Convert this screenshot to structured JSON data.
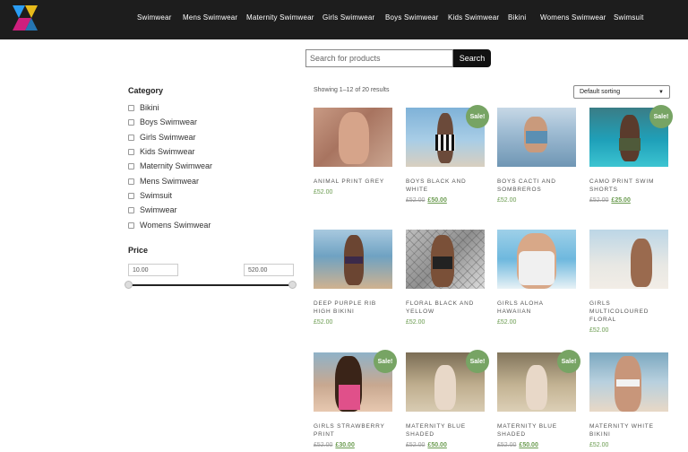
{
  "nav": {
    "items": [
      "Swimwear",
      "Mens Swimwear",
      "Maternity Swimwear",
      "Girls Swimwear",
      "Boys Swimwear",
      "Kids Swimwear",
      "Bikini",
      "Womens Swimwear",
      "Swimsuit"
    ]
  },
  "search": {
    "placeholder": "Search for products",
    "button": "Search"
  },
  "sidebar": {
    "category_title": "Category",
    "categories": [
      "Bikini",
      "Boys Swimwear",
      "Girls Swimwear",
      "Kids Swimwear",
      "Maternity Swimwear",
      "Mens Swimwear",
      "Swimsuit",
      "Swimwear",
      "Womens Swimwear"
    ],
    "price_title": "Price",
    "price_min": "10.00",
    "price_max": "520.00"
  },
  "results": {
    "count_text": "Showing 1–12 of 20 results",
    "sort_selected": "Default sorting"
  },
  "colors": {
    "header_bg": "#1d1d1d",
    "sale_badge": "#77a464",
    "price_green": "#6a9b4f"
  },
  "sale_label": "Sale!",
  "products": [
    {
      "title": "ANIMAL PRINT GREY",
      "price": "£52.00",
      "old_price": "",
      "sale": false
    },
    {
      "title": "BOYS BLACK AND WHITE",
      "price": "£50.00",
      "old_price": "£52.00",
      "sale": true
    },
    {
      "title": "BOYS CACTI AND SOMBREROS",
      "price": "£52.00",
      "old_price": "",
      "sale": false
    },
    {
      "title": "CAMO PRINT SWIM SHORTS",
      "price": "£25.00",
      "old_price": "£52.00",
      "sale": true
    },
    {
      "title": "DEEP PURPLE RIB HIGH BIKINI",
      "price": "£52.00",
      "old_price": "",
      "sale": false
    },
    {
      "title": "FLORAL BLACK AND YELLOW",
      "price": "£52.00",
      "old_price": "",
      "sale": false
    },
    {
      "title": "GIRLS ALOHA HAWAIIAN",
      "price": "£52.00",
      "old_price": "",
      "sale": false
    },
    {
      "title": "GIRLS MULTICOLOURED FLORAL",
      "price": "£52.00",
      "old_price": "",
      "sale": false
    },
    {
      "title": "GIRLS STRAWBERRY PRINT",
      "price": "£30.00",
      "old_price": "£52.00",
      "sale": true
    },
    {
      "title": "MATERNITY BLUE SHADED",
      "price": "£50.00",
      "old_price": "£52.00",
      "sale": true
    },
    {
      "title": "MATERNITY BLUE SHADED",
      "price": "£50.00",
      "old_price": "£52.00",
      "sale": true
    },
    {
      "title": "MATERNITY WHITE BIKINI",
      "price": "£52.00",
      "old_price": "",
      "sale": false
    }
  ]
}
